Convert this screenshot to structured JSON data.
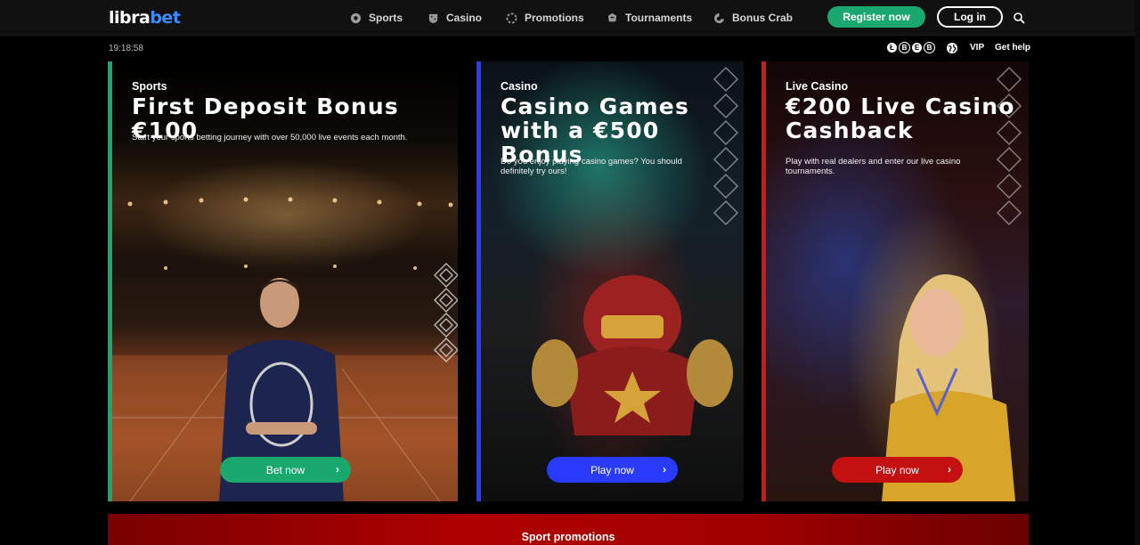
{
  "logo": {
    "part1": "libra",
    "part2": "bet"
  },
  "nav": [
    {
      "label": "Sports",
      "icon": "soccer-ball-icon"
    },
    {
      "label": "Casino",
      "icon": "shield-dice-icon"
    },
    {
      "label": "Promotions",
      "icon": "spinner-icon"
    },
    {
      "label": "Tournaments",
      "icon": "trophy-icon"
    },
    {
      "label": "Bonus Crab",
      "icon": "crab-icon"
    }
  ],
  "auth": {
    "register_label": "Register now",
    "login_label": "Log in"
  },
  "clock": "19:18:58",
  "crypto": [
    "Ł",
    "B",
    "E",
    "B"
  ],
  "utility": {
    "vip_label": "VIP",
    "help_label": "Get help"
  },
  "cards": [
    {
      "category": "Sports",
      "title": "First Deposit Bonus €100",
      "description": "Start your sports betting journey with over 50,000 live events each month.",
      "cta": "Bet now",
      "accent": "#1aa86f"
    },
    {
      "category": "Casino",
      "title": "Casino Games with a €500 Bonus",
      "description": "Do you enjoy playing casino games? You should definitely try ours!",
      "cta": "Play now",
      "accent": "#2a3bff"
    },
    {
      "category": "Live Casino",
      "title": "€200 Live Casino Cashback",
      "description": "Play with real dealers and enter our live casino tournaments.",
      "cta": "Play now",
      "accent": "#d01818"
    }
  ],
  "banner": {
    "label": "Sport promotions"
  }
}
